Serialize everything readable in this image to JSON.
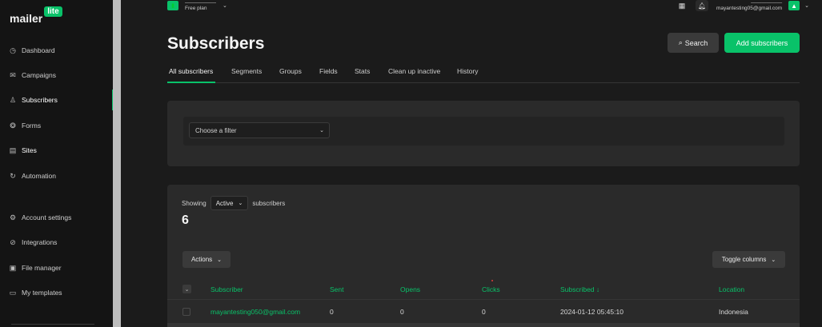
{
  "app": {
    "logo_text": "mailer",
    "logo_badge": "lite"
  },
  "sidebar": {
    "items": [
      {
        "label": "Dashboard",
        "icon": "clock-icon",
        "glyph": "◷"
      },
      {
        "label": "Campaigns",
        "icon": "mail-icon",
        "glyph": "✉"
      },
      {
        "label": "Subscribers",
        "icon": "users-icon",
        "glyph": "♙"
      },
      {
        "label": "Forms",
        "icon": "forms-icon",
        "glyph": "❂"
      },
      {
        "label": "Sites",
        "icon": "sites-icon",
        "glyph": "▤"
      },
      {
        "label": "Automation",
        "icon": "automation-icon",
        "glyph": "↻"
      },
      {
        "label": "Account settings",
        "icon": "settings-icon",
        "glyph": "⚙"
      },
      {
        "label": "Integrations",
        "icon": "link-icon",
        "glyph": "⊘"
      },
      {
        "label": "File manager",
        "icon": "file-manager-icon",
        "glyph": "▣"
      },
      {
        "label": "My templates",
        "icon": "templates-icon",
        "glyph": "▭"
      }
    ],
    "active_index": 2
  },
  "topbar": {
    "account_name": "——————",
    "account_plan": "Free plan",
    "user_name": "——————",
    "user_email": "mayantesting05@gmail.com",
    "avatar_initial": "▲"
  },
  "header": {
    "title": "Subscribers",
    "search_label": "Search",
    "add_label": "Add subscribers"
  },
  "tabs": [
    "All subscribers",
    "Segments",
    "Groups",
    "Fields",
    "Stats",
    "Clean up inactive",
    "History"
  ],
  "filter": {
    "placeholder": "Choose a filter"
  },
  "list": {
    "showing_prefix": "Showing",
    "status_value": "Active",
    "showing_suffix": "subscribers",
    "count": "6",
    "actions_label": "Actions",
    "toggle_columns_label": "Toggle columns",
    "columns": [
      "Subscriber",
      "Sent",
      "Opens",
      "Clicks",
      "Subscribed ↓",
      "Location"
    ],
    "rows": [
      {
        "email": "mayantesting050@gmail.com",
        "sent": "0",
        "opens": "0",
        "clicks": "0",
        "subscribed": "2024-01-12 05:45:10",
        "location": "Indonesia"
      }
    ]
  },
  "colors": {
    "accent": "#09c269",
    "background": "#1b1b1b",
    "panel": "#2a2a2a",
    "sidebar": "#141414"
  }
}
